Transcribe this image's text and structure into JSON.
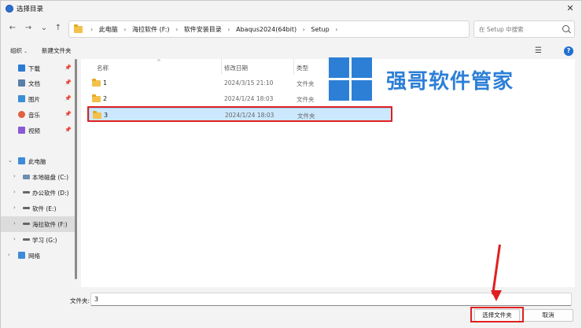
{
  "window": {
    "title": "选择目录",
    "close_glyph": "✕"
  },
  "nav": {
    "back": "←",
    "forward": "→",
    "recent": "⌄",
    "up": "↑",
    "breadcrumbs": [
      "此电脑",
      "海拉软件 (F:)",
      "软件安装目录",
      "Abaqus2024(64bit)",
      "Setup"
    ],
    "breadcrumb_sep": "›",
    "dropdown": "⌄",
    "refresh": "↻",
    "search_placeholder": "在 Setup 中搜索"
  },
  "commands": {
    "organize": "组织",
    "new_folder": "新建文件夹",
    "view_glyph": "☰",
    "help_glyph": "?"
  },
  "sidebar": {
    "quick": [
      {
        "label": "下载",
        "icon": "download-icon",
        "color": "#2b7bd6"
      },
      {
        "label": "文档",
        "icon": "document-icon",
        "color": "#5a7fa8"
      },
      {
        "label": "图片",
        "icon": "picture-icon",
        "color": "#3a8fd6"
      },
      {
        "label": "音乐",
        "icon": "music-icon",
        "color": "#e06040"
      },
      {
        "label": "视频",
        "icon": "video-icon",
        "color": "#8a5ad6"
      }
    ],
    "pin_glyph": "📌",
    "this_pc": "此电脑",
    "drives": [
      {
        "label": "本地磁盘 (C:)"
      },
      {
        "label": "办公软件 (D:)"
      },
      {
        "label": "软件 (E:)"
      },
      {
        "label": "海拉软件 (F:)"
      },
      {
        "label": "学习 (G:)"
      }
    ],
    "network": "网络",
    "chev_right": "›",
    "chev_down": "⌄"
  },
  "columns": {
    "name": "名称",
    "date": "修改日期",
    "type": "类型",
    "sort_caret": "^"
  },
  "rows": [
    {
      "name": "1",
      "date": "2024/3/15 21:10",
      "type": "文件夹"
    },
    {
      "name": "2",
      "date": "2024/1/24 18:03",
      "type": "文件夹"
    },
    {
      "name": "3",
      "date": "2024/1/24 18:03",
      "type": "文件夹"
    }
  ],
  "watermark": {
    "text": "强哥软件管家",
    "color": "#2d7fd6"
  },
  "bottom": {
    "filename_label": "文件夹:",
    "filename_value": "3",
    "select_button": "选择文件夹",
    "cancel_button": "取消"
  },
  "colors": {
    "accent": "#2b6fd6",
    "annotation": "#e02020",
    "selection": "#cce8ff"
  }
}
